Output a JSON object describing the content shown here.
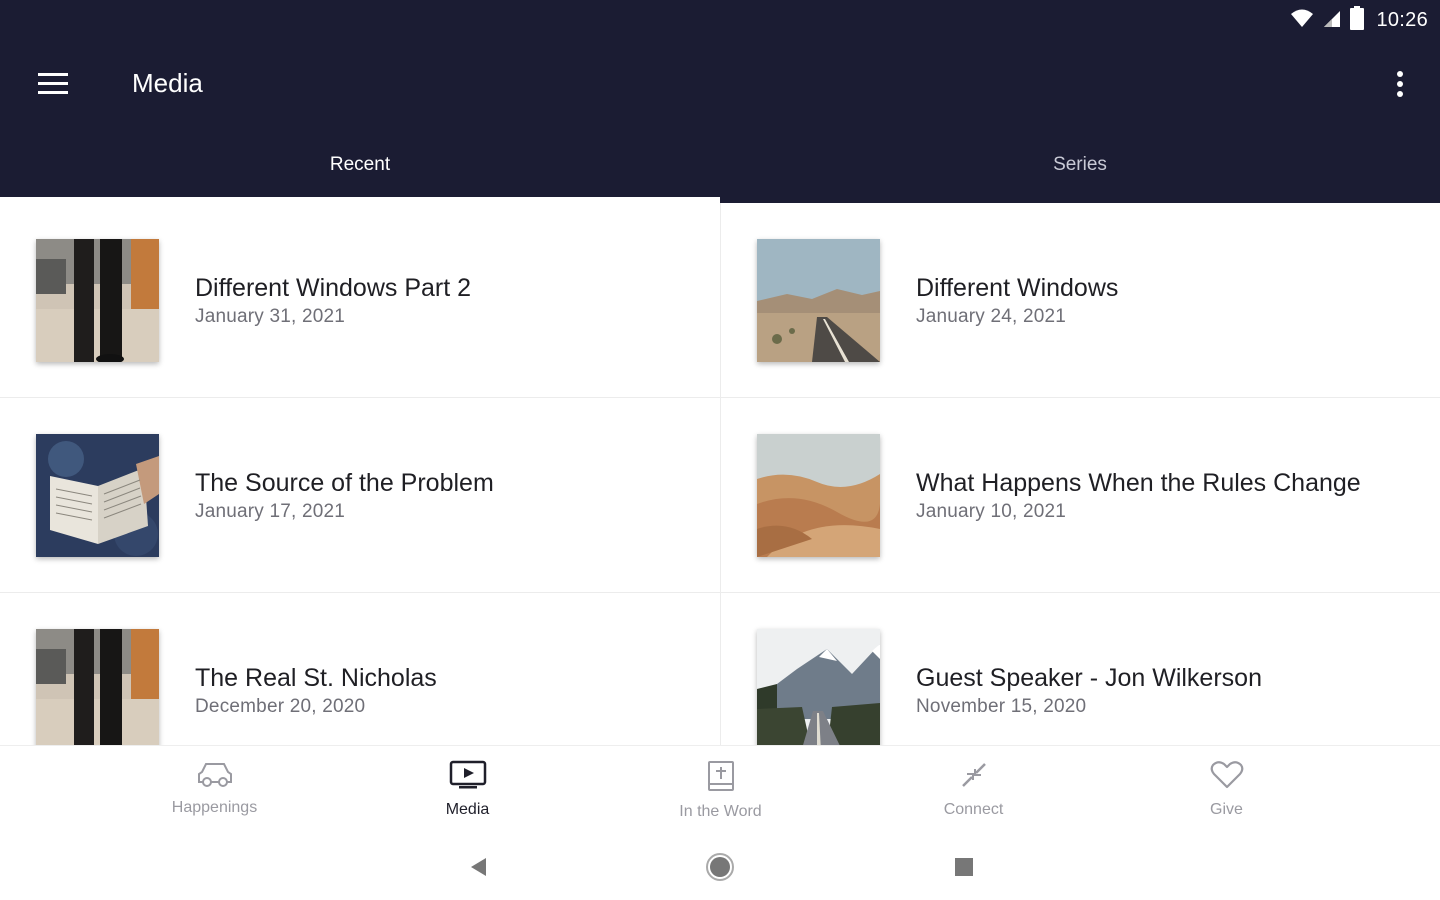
{
  "status_bar": {
    "time": "10:26"
  },
  "toolbar": {
    "title": "Media"
  },
  "tabs": [
    {
      "label": "Recent",
      "active": true
    },
    {
      "label": "Series",
      "active": false
    }
  ],
  "items": [
    {
      "title": "Different Windows Part 2",
      "date": "January 31, 2021",
      "thumb": "walking-legs"
    },
    {
      "title": "Different Windows",
      "date": "January 24, 2021",
      "thumb": "desert-road"
    },
    {
      "title": "The Source of the Problem",
      "date": "January 17, 2021",
      "thumb": "open-bible"
    },
    {
      "title": "What Happens When the Rules Change",
      "date": "January 10, 2021",
      "thumb": "sand-dunes"
    },
    {
      "title": "The Real St. Nicholas",
      "date": "December 20, 2020",
      "thumb": "walking-legs"
    },
    {
      "title": "Guest Speaker - Jon Wilkerson",
      "date": "November 15, 2020",
      "thumb": "mountain-road"
    }
  ],
  "bottom_nav": [
    {
      "label": "Happenings",
      "icon": "car-icon",
      "active": false
    },
    {
      "label": "Media",
      "icon": "tv-icon",
      "active": true
    },
    {
      "label": "In the Word",
      "icon": "bible-icon",
      "active": false
    },
    {
      "label": "Connect",
      "icon": "connect-icon",
      "active": false
    },
    {
      "label": "Give",
      "icon": "heart-icon",
      "active": false
    }
  ],
  "colors": {
    "header_bg": "#1b1c33",
    "active_text": "#ffffff",
    "nav_inactive": "#9a9aa1"
  }
}
